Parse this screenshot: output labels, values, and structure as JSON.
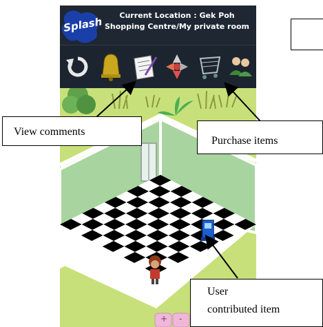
{
  "app": {
    "logo_text": "Splash",
    "location_line1": "Current Location : Gek Poh",
    "location_line2": "Shopping Centre/My private room"
  },
  "toolbar": {
    "icons": [
      "refresh-icon",
      "bell-icon",
      "comment-note-icon",
      "navigate-arrows-icon",
      "shopping-cart-icon",
      "users-icon"
    ]
  },
  "room": {
    "floor_buttons": [
      "+",
      "-"
    ]
  },
  "callouts": {
    "view_comments": "View comments",
    "purchase_items": "Purchase items",
    "user_contributed_line1": "User",
    "user_contributed_line2": "contributed item"
  },
  "colors": {
    "header_bg": "#1f2733",
    "grass": "#c8e07a",
    "wall": "#a8d8a0",
    "logo_blue": "#1a3fa8"
  }
}
